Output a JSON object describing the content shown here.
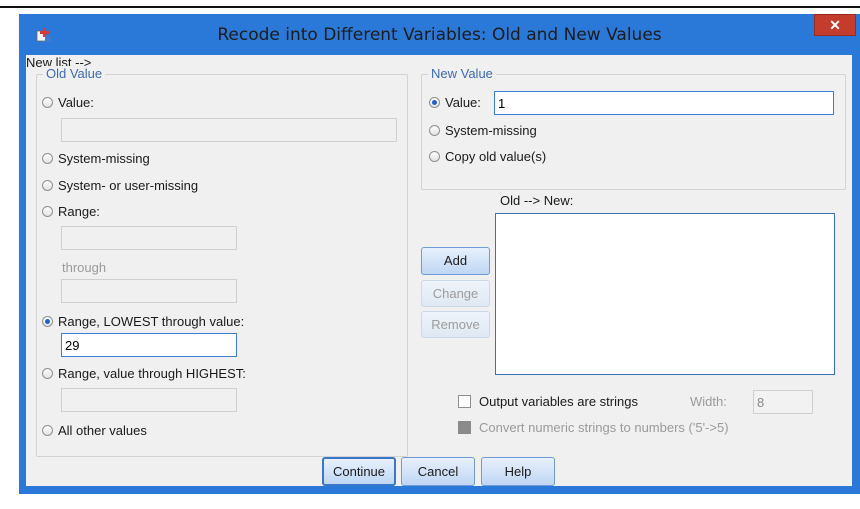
{
  "window": {
    "title": "Recode into Different Variables: Old and New Values",
    "close_glyph": "✕",
    "app_icon": "spss-recode-icon"
  },
  "old_value": {
    "group_label": "Old Value",
    "value_label": "Value:",
    "value_input": "",
    "system_missing_label": "System-missing",
    "system_or_user_missing_label": "System- or user-missing",
    "range_label": "Range:",
    "range_from": "",
    "through_label": "through",
    "range_to": "",
    "range_lowest_label": "Range, LOWEST through value:",
    "range_lowest_value": "29",
    "range_highest_label": "Range, value through HIGHEST:",
    "range_highest_value": "",
    "all_other_label": "All other values",
    "selected": "range_lowest"
  },
  "new_value": {
    "group_label": "New Value",
    "value_label": "Value:",
    "value_input": "1",
    "system_missing_label": "System-missing",
    "copy_old_label": "Copy old value(s)",
    "selected": "value"
  },
  "mapping": {
    "list_label": "Old --> New:",
    "items": [],
    "add_label": "Add",
    "change_label": "Change",
    "remove_label": "Remove"
  },
  "options": {
    "output_strings_label": "Output variables are strings",
    "output_strings_checked": false,
    "width_label": "Width:",
    "width_value": "8",
    "convert_label": "Convert numeric strings to numbers ('5'->5)",
    "convert_checked": false
  },
  "footer": {
    "continue_label": "Continue",
    "cancel_label": "Cancel",
    "help_label": "Help"
  },
  "colors": {
    "title_bar": "#2a79d8",
    "group_label": "#3d6ab6",
    "close_button": "#c43c2c"
  }
}
